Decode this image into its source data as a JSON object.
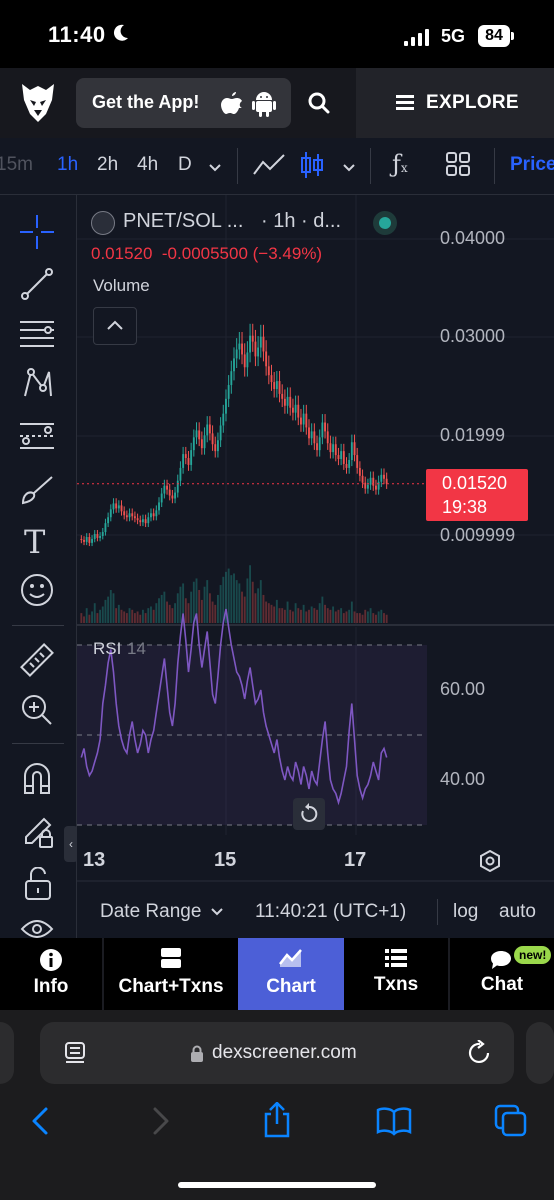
{
  "status": {
    "time": "11:40",
    "network": "5G",
    "battery": "84"
  },
  "header": {
    "promo_label": "Get the App!",
    "explore_label": "EXPLORE"
  },
  "toolbar": {
    "intervals": [
      "15m",
      "1h",
      "2h",
      "4h",
      "D"
    ],
    "active_interval": "1h",
    "price_label": "Price"
  },
  "chart": {
    "symbol": "PNET/SOL ...",
    "interval": "· 1h · d...",
    "quote": "0.01520  -0.0005500 (−3.49%)",
    "volume_label": "Volume",
    "price_axis": [
      "0.04000",
      "0.03000",
      "0.01999",
      "0.009999"
    ],
    "current_price": "0.01520",
    "countdown": "19:38",
    "rsi_label": "RSI",
    "rsi_period": "14",
    "rsi_axis": [
      "60.00",
      "40.00"
    ],
    "date_ticks": [
      "13",
      "15",
      "17"
    ],
    "footer": {
      "date_range": "Date Range",
      "clock": "11:40:21 (UTC+1)",
      "log": "log",
      "auto": "auto"
    },
    "colors": {
      "up": "#26a69a",
      "down": "#ef5350",
      "rsi": "#7e57c2",
      "price_tag": "#f23645"
    }
  },
  "chart_data": [
    {
      "type": "candlestick",
      "title": "PNET/SOL",
      "x_ticks": [
        "13",
        "15",
        "17"
      ],
      "y_ticks": [
        "0.009999",
        "0.01999",
        "0.03000",
        "0.04000"
      ],
      "ylim": [
        0.0,
        0.046
      ],
      "last_price": 0.0152,
      "close": [
        0.0095,
        0.0093,
        0.0098,
        0.0092,
        0.0096,
        0.0101,
        0.0097,
        0.0099,
        0.0103,
        0.0112,
        0.0118,
        0.0126,
        0.0132,
        0.0127,
        0.013,
        0.0124,
        0.012,
        0.0118,
        0.0122,
        0.0119,
        0.0117,
        0.0115,
        0.0113,
        0.0116,
        0.0112,
        0.0118,
        0.0122,
        0.0119,
        0.0125,
        0.0133,
        0.0142,
        0.015,
        0.0146,
        0.014,
        0.0137,
        0.0143,
        0.0155,
        0.0168,
        0.0182,
        0.0178,
        0.0171,
        0.0186,
        0.0199,
        0.0206,
        0.0197,
        0.0188,
        0.0201,
        0.0212,
        0.0203,
        0.0192,
        0.0185,
        0.0196,
        0.0211,
        0.0223,
        0.0238,
        0.0252,
        0.0266,
        0.0279,
        0.0288,
        0.0294,
        0.0283,
        0.027,
        0.0285,
        0.0302,
        0.0296,
        0.0281,
        0.029,
        0.0301,
        0.0286,
        0.0271,
        0.0262,
        0.0255,
        0.0248,
        0.0256,
        0.0243,
        0.0238,
        0.0231,
        0.024,
        0.0229,
        0.0224,
        0.0232,
        0.0219,
        0.0212,
        0.0223,
        0.0209,
        0.0198,
        0.0205,
        0.0193,
        0.0186,
        0.0199,
        0.0214,
        0.0205,
        0.0193,
        0.0184,
        0.0192,
        0.0181,
        0.0177,
        0.0185,
        0.0172,
        0.0168,
        0.0176,
        0.0194,
        0.0181,
        0.0168,
        0.016,
        0.0153,
        0.0147,
        0.0151,
        0.0158,
        0.015,
        0.0146,
        0.0154,
        0.0161,
        0.0157,
        0.0152
      ],
      "volume": [
        6,
        4,
        9,
        5,
        7,
        12,
        6,
        8,
        10,
        14,
        16,
        20,
        18,
        9,
        11,
        8,
        7,
        6,
        9,
        8,
        6,
        7,
        5,
        8,
        6,
        9,
        10,
        8,
        12,
        15,
        17,
        19,
        13,
        11,
        9,
        12,
        18,
        22,
        24,
        15,
        12,
        19,
        25,
        27,
        20,
        14,
        22,
        26,
        18,
        13,
        11,
        17,
        23,
        28,
        31,
        33,
        29,
        30,
        26,
        24,
        19,
        16,
        27,
        35,
        25,
        18,
        21,
        26,
        17,
        13,
        12,
        11,
        10,
        14,
        9,
        9,
        8,
        13,
        8,
        7,
        12,
        9,
        8,
        11,
        7,
        8,
        10,
        9,
        8,
        12,
        16,
        11,
        9,
        8,
        10,
        7,
        8,
        9,
        6,
        7,
        8,
        13,
        7,
        6,
        6,
        5,
        8,
        7,
        9,
        6,
        5,
        7,
        8,
        6,
        5
      ],
      "series": [
        {
          "name": "Volume"
        }
      ]
    },
    {
      "type": "line",
      "title": "RSI 14",
      "y_ticks": [
        "40.00",
        "60.00"
      ],
      "ylim": [
        20,
        80
      ],
      "bands": [
        30,
        50,
        70
      ],
      "values": [
        45,
        47,
        43,
        41,
        42,
        44,
        46,
        49,
        57,
        61,
        66,
        69,
        64,
        57,
        52,
        49,
        47,
        46,
        50,
        53,
        49,
        46,
        48,
        51,
        50,
        46,
        49,
        51,
        55,
        59,
        63,
        67,
        61,
        55,
        52,
        57,
        66,
        72,
        77,
        71,
        64,
        69,
        75,
        77,
        70,
        65,
        69,
        73,
        66,
        59,
        57,
        63,
        70,
        75,
        78,
        74,
        70,
        67,
        64,
        63,
        61,
        58,
        62,
        65,
        61,
        57,
        58,
        60,
        55,
        52,
        50,
        48,
        46,
        49,
        45,
        42,
        40,
        43,
        41,
        40,
        44,
        42,
        39,
        43,
        41,
        38,
        42,
        40,
        39,
        44,
        49,
        53,
        46,
        40,
        38,
        37,
        35,
        37,
        40,
        43,
        51,
        57,
        49,
        41,
        38,
        36,
        38,
        39,
        41,
        44,
        42,
        40,
        46,
        47,
        45
      ]
    }
  ],
  "tabs": [
    {
      "label": "Info",
      "icon": "info-icon"
    },
    {
      "label": "Chart+Txns",
      "icon": "chart-txns-icon"
    },
    {
      "label": "Chart",
      "icon": "chart-icon",
      "active": true
    },
    {
      "label": "Txns",
      "icon": "list-icon"
    },
    {
      "label": "Chat",
      "icon": "chat-icon",
      "badge": "new!"
    }
  ],
  "browser": {
    "url": "dexscreener.com"
  }
}
